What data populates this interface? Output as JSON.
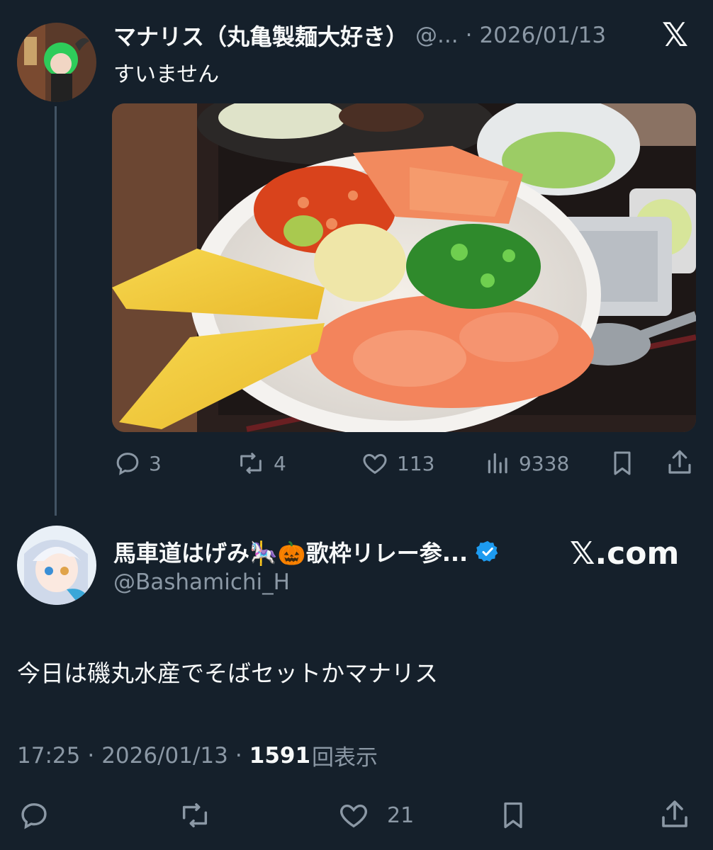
{
  "quoted_tweet": {
    "author_name": "マナリス（丸亀製麺大好き）",
    "handle_truncated": "@...",
    "separator": "·",
    "date": "2026/01/13",
    "text": "すいません",
    "actions": {
      "replies": "3",
      "reposts": "4",
      "likes": "113",
      "views": "9338"
    }
  },
  "main_tweet": {
    "author_name": "馬車道はげみ🎠🎃歌枠リレー参...",
    "handle": "@Bashamichi_H",
    "text": "今日は磯丸水産でそばセットかマナリス",
    "time": "17:25",
    "date": "2026/01/13",
    "separator": "·",
    "view_count": "1591",
    "view_label": "回表示",
    "likes": "21"
  },
  "branding": {
    "x_logo": "𝕏",
    "x_com": "𝕏.com"
  },
  "colors": {
    "background": "#15202b",
    "text": "#f7f9f9",
    "muted": "#8b98a5",
    "verified": "#1d9bf0"
  }
}
